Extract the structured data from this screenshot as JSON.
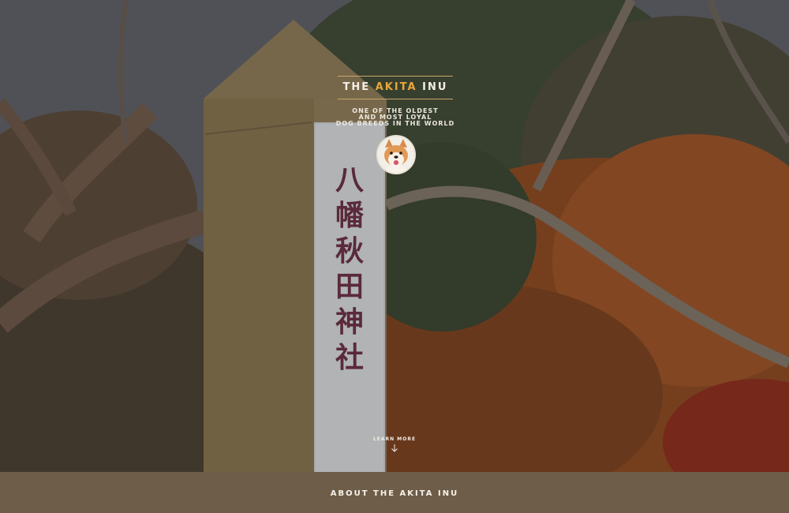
{
  "hero": {
    "brand_prefix": "THE",
    "brand_accent": "AKITA",
    "brand_suffix": "INU",
    "tagline_lines": [
      "ONE OF THE OLDEST",
      "AND MOST LOYAL",
      "DOG BREEDS IN THE WORLD"
    ],
    "avatar_icon": "akita-dog-avatar",
    "learn_more": "LEARN MORE",
    "learn_more_icon": "arrow-down-icon",
    "pillar_text": [
      "八",
      "幡",
      "秋",
      "田",
      "神",
      "社"
    ]
  },
  "about": {
    "title": "ABOUT THE AKITA INU"
  },
  "colors": {
    "accent": "#e8a838",
    "rule": "#c9a56b",
    "bar_bg": "#6e5d48"
  }
}
